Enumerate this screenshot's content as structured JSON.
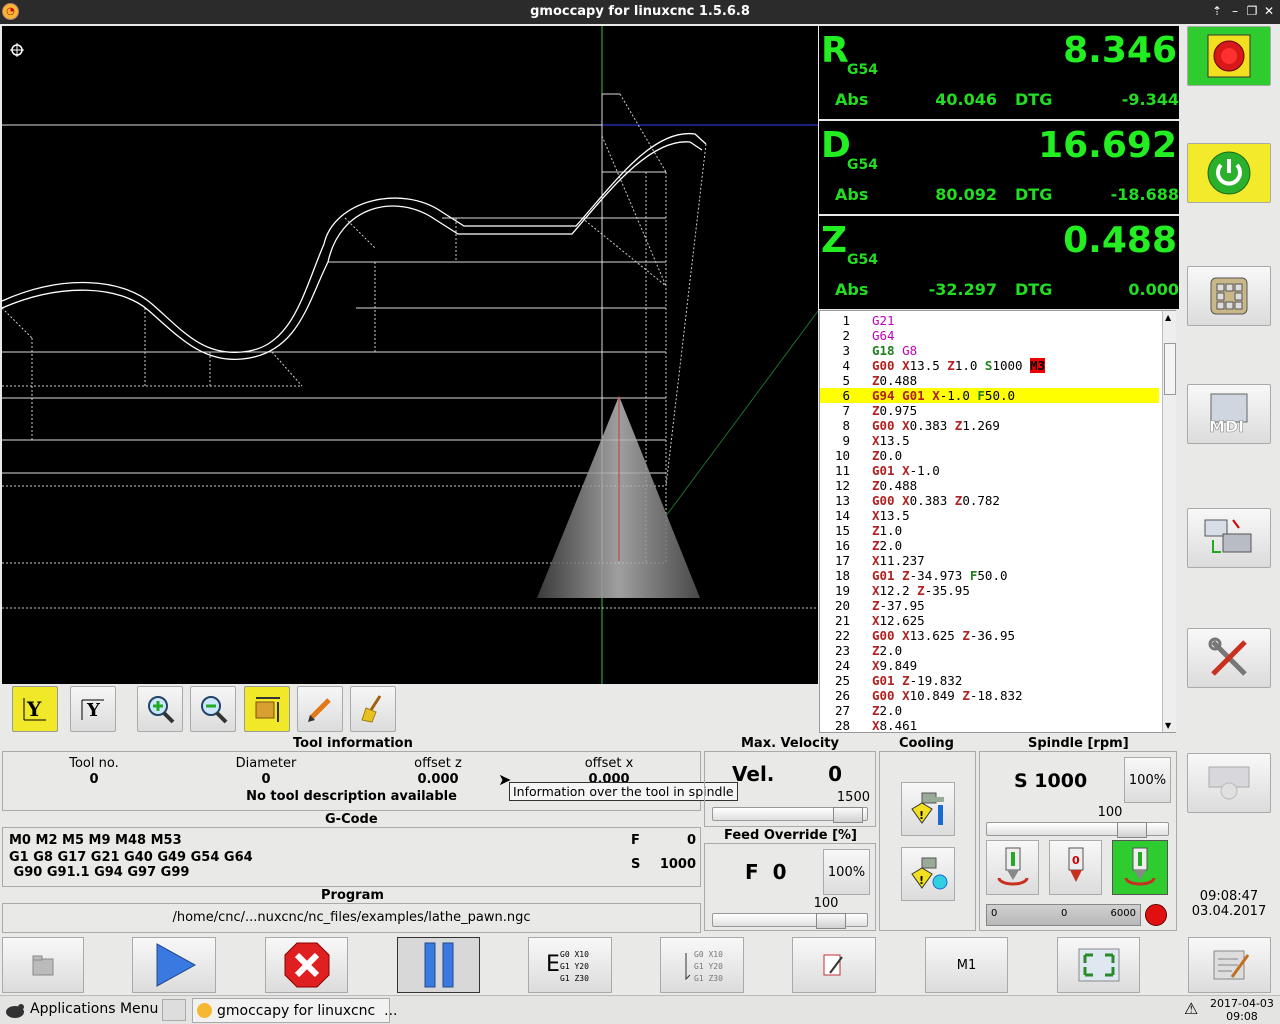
{
  "window": {
    "title": "gmoccapy for linuxcnc  1.5.6.8"
  },
  "dro": [
    {
      "axis": "R",
      "coord": "G54",
      "value": "8.346",
      "abs_label": "Abs",
      "abs": "40.046",
      "dtg_label": "DTG",
      "dtg": "-9.344"
    },
    {
      "axis": "D",
      "coord": "G54",
      "value": "16.692",
      "abs_label": "Abs",
      "abs": "80.092",
      "dtg_label": "DTG",
      "dtg": "-18.688"
    },
    {
      "axis": "Z",
      "coord": "G54",
      "value": "0.488",
      "abs_label": "Abs",
      "abs": "-32.297",
      "dtg_label": "DTG",
      "dtg": "0.000"
    }
  ],
  "gcode_lines": [
    {
      "n": "1",
      "parts": [
        [
          "G21",
          "m"
        ]
      ]
    },
    {
      "n": "2",
      "parts": [
        [
          "G64",
          "m"
        ]
      ]
    },
    {
      "n": "3",
      "parts": [
        [
          "G18 ",
          "gr"
        ],
        [
          "G8",
          "m"
        ]
      ]
    },
    {
      "n": "4",
      "parts": [
        [
          "G00 ",
          "g"
        ],
        [
          "X",
          "x"
        ],
        [
          "13.5 ",
          ""
        ],
        [
          "Z",
          "x"
        ],
        [
          "1.0 ",
          ""
        ],
        [
          "S",
          "gr"
        ],
        [
          "1000 ",
          ""
        ],
        [
          "M3",
          "red"
        ]
      ]
    },
    {
      "n": "5",
      "parts": [
        [
          "Z",
          "x"
        ],
        [
          "0.488",
          ""
        ]
      ]
    },
    {
      "n": "6",
      "parts": [
        [
          "G94 ",
          "g"
        ],
        [
          "G01 ",
          "g"
        ],
        [
          "X",
          "x"
        ],
        [
          "-1.0 ",
          ""
        ],
        [
          "F",
          "gr"
        ],
        [
          "50.0",
          ""
        ]
      ],
      "current": true
    },
    {
      "n": "7",
      "parts": [
        [
          "Z",
          "x"
        ],
        [
          "0.975",
          ""
        ]
      ]
    },
    {
      "n": "8",
      "parts": [
        [
          "G00 ",
          "g"
        ],
        [
          "X",
          "x"
        ],
        [
          "0.383 ",
          ""
        ],
        [
          "Z",
          "x"
        ],
        [
          "1.269",
          ""
        ]
      ]
    },
    {
      "n": "9",
      "parts": [
        [
          "X",
          "x"
        ],
        [
          "13.5",
          ""
        ]
      ]
    },
    {
      "n": "10",
      "parts": [
        [
          "Z",
          "x"
        ],
        [
          "0.0",
          ""
        ]
      ]
    },
    {
      "n": "11",
      "parts": [
        [
          "G01 ",
          "g"
        ],
        [
          "X",
          "x"
        ],
        [
          "-1.0",
          ""
        ]
      ]
    },
    {
      "n": "12",
      "parts": [
        [
          "Z",
          "x"
        ],
        [
          "0.488",
          ""
        ]
      ]
    },
    {
      "n": "13",
      "parts": [
        [
          "G00 ",
          "g"
        ],
        [
          "X",
          "x"
        ],
        [
          "0.383 ",
          ""
        ],
        [
          "Z",
          "x"
        ],
        [
          "0.782",
          ""
        ]
      ]
    },
    {
      "n": "14",
      "parts": [
        [
          "X",
          "x"
        ],
        [
          "13.5",
          ""
        ]
      ]
    },
    {
      "n": "15",
      "parts": [
        [
          "Z",
          "x"
        ],
        [
          "1.0",
          ""
        ]
      ]
    },
    {
      "n": "16",
      "parts": [
        [
          "Z",
          "x"
        ],
        [
          "2.0",
          ""
        ]
      ]
    },
    {
      "n": "17",
      "parts": [
        [
          "X",
          "x"
        ],
        [
          "11.237",
          ""
        ]
      ]
    },
    {
      "n": "18",
      "parts": [
        [
          "G01 ",
          "g"
        ],
        [
          "Z",
          "x"
        ],
        [
          "-34.973 ",
          ""
        ],
        [
          "F",
          "gr"
        ],
        [
          "50.0",
          ""
        ]
      ]
    },
    {
      "n": "19",
      "parts": [
        [
          "X",
          "x"
        ],
        [
          "12.2 ",
          ""
        ],
        [
          "Z",
          "x"
        ],
        [
          "-35.95",
          ""
        ]
      ]
    },
    {
      "n": "20",
      "parts": [
        [
          "Z",
          "x"
        ],
        [
          "-37.95",
          ""
        ]
      ]
    },
    {
      "n": "21",
      "parts": [
        [
          "X",
          "x"
        ],
        [
          "12.625",
          ""
        ]
      ]
    },
    {
      "n": "22",
      "parts": [
        [
          "G00 ",
          "g"
        ],
        [
          "X",
          "x"
        ],
        [
          "13.625 ",
          ""
        ],
        [
          "Z",
          "x"
        ],
        [
          "-36.95",
          ""
        ]
      ]
    },
    {
      "n": "23",
      "parts": [
        [
          "Z",
          "x"
        ],
        [
          "2.0",
          ""
        ]
      ]
    },
    {
      "n": "24",
      "parts": [
        [
          "X",
          "x"
        ],
        [
          "9.849",
          ""
        ]
      ]
    },
    {
      "n": "25",
      "parts": [
        [
          "G01 ",
          "g"
        ],
        [
          "Z",
          "x"
        ],
        [
          "-19.832",
          ""
        ]
      ]
    },
    {
      "n": "26",
      "parts": [
        [
          "G00 ",
          "g"
        ],
        [
          "X",
          "x"
        ],
        [
          "10.849 ",
          ""
        ],
        [
          "Z",
          "x"
        ],
        [
          "-18.832",
          ""
        ]
      ]
    },
    {
      "n": "27",
      "parts": [
        [
          "Z",
          "x"
        ],
        [
          "2.0",
          ""
        ]
      ]
    },
    {
      "n": "28",
      "parts": [
        [
          "X",
          "x"
        ],
        [
          "8.461",
          ""
        ]
      ]
    }
  ],
  "tool_info": {
    "title": "Tool information",
    "tool_no_label": "Tool no.",
    "tool_no": "0",
    "diameter_label": "Diameter",
    "diameter": "0",
    "offset_z_label": "offset z",
    "offset_z": "0.000",
    "offset_x_label": "offset x",
    "offset_x": "0.000",
    "description": "No tool description available",
    "tooltip": "Information over the tool in spindle"
  },
  "gcode_info": {
    "title": "G-Code",
    "line1": "M0 M2 M5 M9 M48 M53",
    "line2": "G1 G8 G17 G21 G40 G49 G54 G64",
    "line3": " G90 G91.1 G94 G97 G99",
    "f_label": "F",
    "f_value": "0",
    "s_label": "S",
    "s_value": "1000"
  },
  "program": {
    "title": "Program",
    "path": "/home/cnc/...nuxcnc/nc_files/examples/lathe_pawn.ngc"
  },
  "max_velocity": {
    "title": "Max. Velocity",
    "label": "Vel.",
    "value": "0",
    "max": "1500",
    "slider_fraction": 0.95
  },
  "feed_override": {
    "title": "Feed Override [%]",
    "label": "F  0",
    "reset": "100%",
    "value": "100",
    "slider_fraction": 0.82
  },
  "cooling": {
    "title": "Cooling"
  },
  "spindle": {
    "title": "Spindle [rpm]",
    "speed": "S 1000",
    "reset": "100%",
    "override": "100",
    "bar_min": "0",
    "bar_value": "0",
    "bar_max": "6000",
    "slider_fraction": 0.85
  },
  "clock": {
    "time": "09:08:47",
    "date": "03.04.2017"
  },
  "bottom_buttons": {
    "m1": "M1",
    "step1": "G0  X10\nG1  Y20\nG1  Z30"
  },
  "taskbar": {
    "apps_menu": "Applications Menu",
    "task": "gmoccapy for linuxcnc  ...",
    "date": "2017-04-03",
    "time": "09:08"
  },
  "colors": {
    "dro_green": "#22ee22",
    "highlight": "#ffff00",
    "estop_green": "#22cc22",
    "power_yellow": "#f2ea2a"
  }
}
